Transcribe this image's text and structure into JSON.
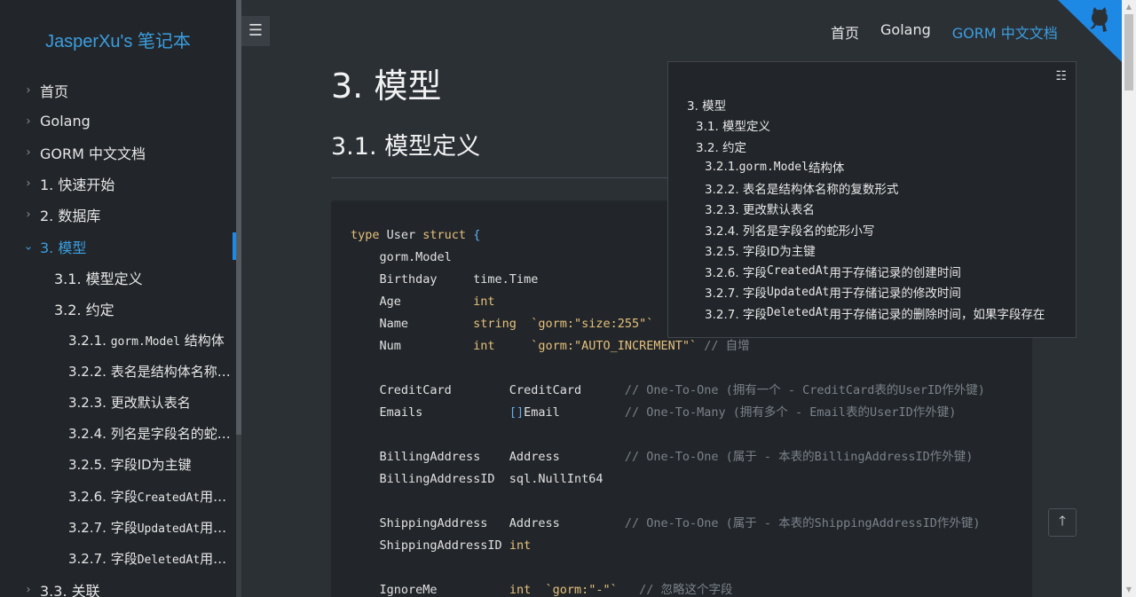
{
  "site": {
    "title": "JasperXu's 笔记本"
  },
  "sidebar": {
    "items": [
      {
        "label": "首页",
        "level": 1,
        "chevron": "›"
      },
      {
        "label": "Golang",
        "level": 1,
        "chevron": "›"
      },
      {
        "label": "GORM 中文文档",
        "level": 1,
        "chevron": "›"
      },
      {
        "label": "1. 快速开始",
        "level": 1,
        "chevron": "›"
      },
      {
        "label": "2. 数据库",
        "level": 1,
        "chevron": "›"
      },
      {
        "label": "3. 模型",
        "level": 1,
        "chevron": "⌄",
        "active": true
      },
      {
        "label": "3.1. 模型定义",
        "level": 2
      },
      {
        "label": "3.2. 约定",
        "level": 2
      },
      {
        "label_prefix": "3.2.1. ",
        "label_code": "gorm.Model",
        "label_suffix": " 结构体",
        "level": 3
      },
      {
        "label": "3.2.2. 表名是结构体名称…",
        "level": 3
      },
      {
        "label": "3.2.3. 更改默认表名",
        "level": 3
      },
      {
        "label": "3.2.4. 列名是字段名的蛇…",
        "level": 3
      },
      {
        "label": "3.2.5. 字段ID为主键",
        "level": 3
      },
      {
        "label_prefix": "3.2.6. 字段",
        "label_code": "CreatedAt",
        "label_suffix": "用…",
        "level": 3
      },
      {
        "label_prefix": "3.2.7. 字段",
        "label_code": "UpdatedAt",
        "label_suffix": "用…",
        "level": 3
      },
      {
        "label_prefix": "3.2.7. 字段",
        "label_code": "DeletedAt",
        "label_suffix": "用…",
        "level": 3
      },
      {
        "label": "3.3. 关联",
        "level": 1,
        "chevron": "›"
      }
    ]
  },
  "menu_toggle": {
    "icon": "hamburger-icon",
    "glyph": "☰"
  },
  "topnav": {
    "links": [
      {
        "label": "首页"
      },
      {
        "label": "Golang"
      },
      {
        "label": "GORM 中文文档",
        "current": true
      }
    ]
  },
  "colors": {
    "accent": "#3b9ee0",
    "background": "#2b3035",
    "sidebar": "#22262a",
    "active_bar": "#1e88e5",
    "github_corner": "#1e88e5"
  },
  "main": {
    "h1": "3. 模型",
    "h2": "3.1. 模型定义"
  },
  "toc": {
    "icon_glyph": "☷",
    "items": [
      {
        "level": 1,
        "text": "3. 模型"
      },
      {
        "level": 2,
        "text": "3.1. 模型定义"
      },
      {
        "level": 2,
        "text": "3.2. 约定"
      },
      {
        "level": 3,
        "prefix": "3.2.1. ",
        "code": "gorm.Model",
        "suffix": " 结构体"
      },
      {
        "level": 3,
        "text": "3.2.2. 表名是结构体名称的复数形式"
      },
      {
        "level": 3,
        "text": "3.2.3. 更改默认表名"
      },
      {
        "level": 3,
        "text": "3.2.4. 列名是字段名的蛇形小写"
      },
      {
        "level": 3,
        "text": "3.2.5. 字段ID为主键"
      },
      {
        "level": 3,
        "prefix": "3.2.6. 字段",
        "code": "CreatedAt",
        "suffix": "用于存储记录的创建时间"
      },
      {
        "level": 3,
        "prefix": "3.2.7. 字段",
        "code": "UpdatedAt",
        "suffix": "用于存储记录的修改时间"
      },
      {
        "level": 3,
        "prefix": "3.2.7. 字段",
        "code": "DeletedAt",
        "suffix": "用于存储记录的删除时间，如果字段存在"
      }
    ]
  },
  "code": {
    "lines": [
      [
        [
          "k",
          "type "
        ],
        [
          "",
          "User "
        ],
        [
          "k",
          "struct "
        ],
        [
          "p",
          "{"
        ]
      ],
      [
        [
          "",
          "    gorm.Model"
        ]
      ],
      [
        [
          "",
          "    Birthday     time.Time"
        ]
      ],
      [
        [
          "",
          "    Age          "
        ],
        [
          "t",
          "int"
        ]
      ],
      [
        [
          "",
          "    Name         "
        ],
        [
          "t",
          "string"
        ],
        [
          "",
          "  "
        ],
        [
          "s",
          "`gorm:\"size:255\"`"
        ]
      ],
      [
        [
          "",
          "    Num          "
        ],
        [
          "t",
          "int"
        ],
        [
          "",
          "     "
        ],
        [
          "s",
          "`gorm:\"AUTO_INCREMENT\"`"
        ],
        [
          "c",
          " // 自增"
        ]
      ],
      [
        [
          "",
          ""
        ]
      ],
      [
        [
          "",
          "    CreditCard        CreditCard      "
        ],
        [
          "c",
          "// One-To-One (拥有一个 - CreditCard表的UserID作外键)"
        ]
      ],
      [
        [
          "",
          "    Emails            "
        ],
        [
          "p",
          "[]"
        ],
        [
          "",
          "Email         "
        ],
        [
          "c",
          "// One-To-Many (拥有多个 - Email表的UserID作外键)"
        ]
      ],
      [
        [
          "",
          ""
        ]
      ],
      [
        [
          "",
          "    BillingAddress    Address         "
        ],
        [
          "c",
          "// One-To-One (属于 - 本表的BillingAddressID作外键)"
        ]
      ],
      [
        [
          "",
          "    BillingAddressID  sql.NullInt64"
        ]
      ],
      [
        [
          "",
          ""
        ]
      ],
      [
        [
          "",
          "    ShippingAddress   Address         "
        ],
        [
          "c",
          "// One-To-One (属于 - 本表的ShippingAddressID作外键)"
        ]
      ],
      [
        [
          "",
          "    ShippingAddressID "
        ],
        [
          "t",
          "int"
        ]
      ],
      [
        [
          "",
          ""
        ]
      ],
      [
        [
          "",
          "    IgnoreMe          "
        ],
        [
          "t",
          "int"
        ],
        [
          "",
          "  "
        ],
        [
          "s",
          "`gorm:\"-\"`"
        ],
        [
          "c",
          "   // 忽略这个字段"
        ]
      ]
    ]
  },
  "back_to_top": {
    "icon": "arrow-up-icon",
    "glyph": "🡑"
  }
}
